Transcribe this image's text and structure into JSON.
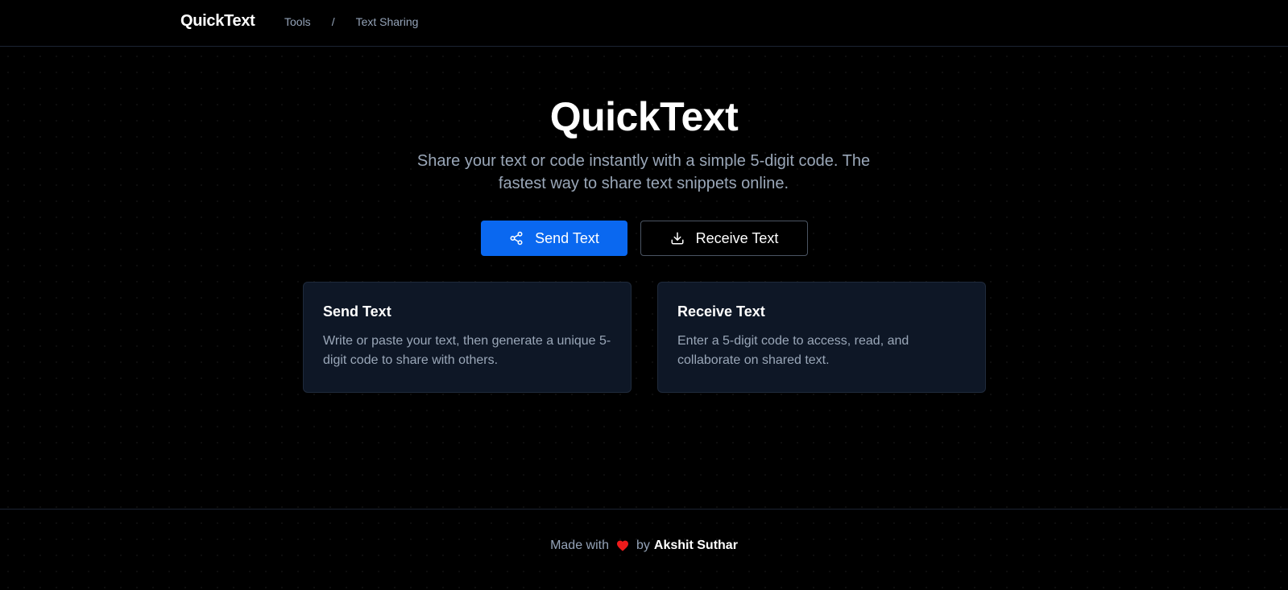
{
  "header": {
    "brand": "QuickText",
    "breadcrumb": [
      "Tools",
      "/",
      "Text Sharing"
    ]
  },
  "hero": {
    "title": "QuickText",
    "subtitle": "Share your text or code instantly with a simple 5-digit code. The fastest way to share text snippets online."
  },
  "actions": {
    "send_label": "Send Text",
    "send_icon": "share-icon",
    "receive_label": "Receive Text",
    "receive_icon": "download-icon"
  },
  "cards": [
    {
      "title": "Send Text",
      "description": "Write or paste your text, then generate a unique 5-digit code to share with others."
    },
    {
      "title": "Receive Text",
      "description": "Enter a 5-digit code to access, read, and collaborate on shared text."
    }
  ],
  "footer": {
    "made_with": "Made with",
    "heart_icon": "heart-icon",
    "by": "by",
    "author": "Akshit Suthar"
  },
  "colors": {
    "background": "#000000",
    "primary": "#0a68f0",
    "card_bg": "#0e1726",
    "muted_text": "#9aa7b8",
    "heart": "#ef1b1b"
  }
}
